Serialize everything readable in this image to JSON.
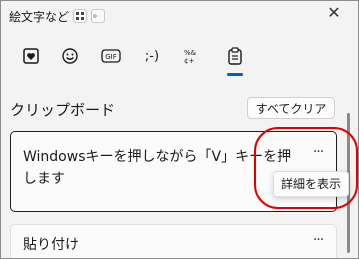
{
  "window": {
    "title": "絵文字など",
    "close_glyph": "✕"
  },
  "chips": {
    "kuten": "。"
  },
  "tabs": [
    {
      "icon": "heart-sticker-icon",
      "active": false
    },
    {
      "icon": "smiley-icon",
      "active": false
    },
    {
      "icon": "gif-icon",
      "label": "GIF",
      "active": false
    },
    {
      "icon": "kaomoji-icon",
      "label": ";-)",
      "active": false
    },
    {
      "icon": "symbols-icon",
      "label": "%&\n¢+",
      "active": false
    },
    {
      "icon": "clipboard-icon",
      "active": true
    }
  ],
  "clipboard": {
    "title": "クリップボード",
    "clear_all": "すべてクリア",
    "items": [
      {
        "text": "Windowsキーを押しながら「V」キーを押します",
        "more": "···"
      },
      {
        "text": "貼り付け",
        "more": "···"
      }
    ],
    "tooltip": "詳細を表示"
  },
  "colors": {
    "accent": "#005fb8",
    "annotation": "#e00000"
  }
}
